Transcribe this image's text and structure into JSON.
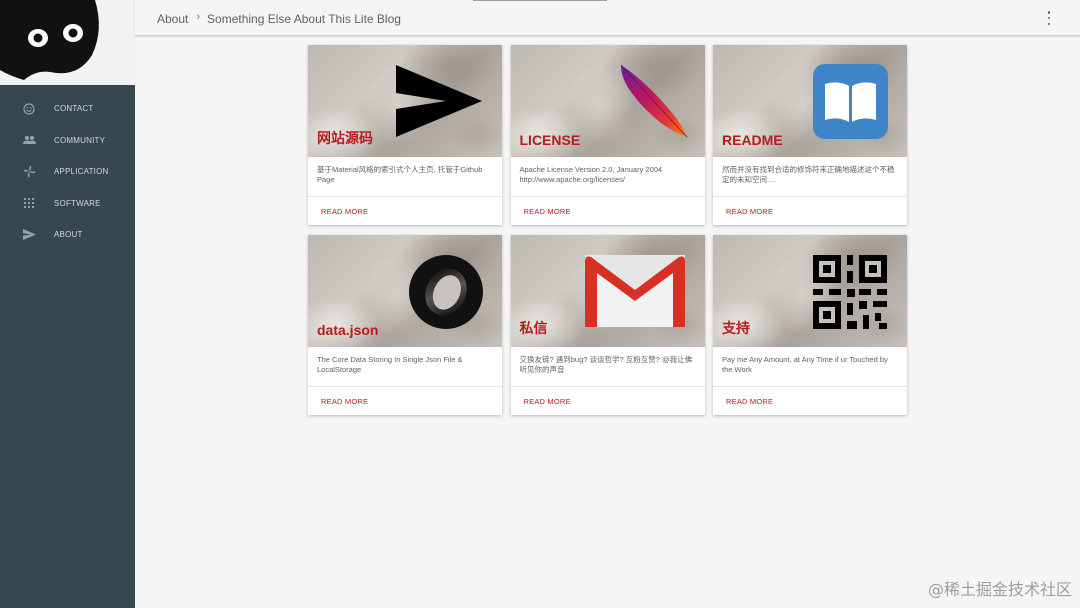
{
  "header": {
    "breadcrumb": [
      "About",
      "Something Else About This Lite Blog"
    ],
    "separator": "›"
  },
  "sidebar": {
    "items": [
      {
        "label": "CONTACT",
        "icon": "smile-icon"
      },
      {
        "label": "COMMUNITY",
        "icon": "group-icon"
      },
      {
        "label": "APPLICATION",
        "icon": "pinwheel-icon"
      },
      {
        "label": "SOFTWARE",
        "icon": "apps-grid-icon"
      },
      {
        "label": "ABOUT",
        "icon": "send-icon"
      }
    ]
  },
  "cards": [
    {
      "title": "网站源码",
      "text": "基于Material风格的索引式个人主页, 托管于Github Page",
      "action": "READ MORE",
      "logo": "send-arrow-icon"
    },
    {
      "title": "LICENSE",
      "text": "Apache License Version 2.0, January 2004 http://www.apache.org/licenses/",
      "action": "READ MORE",
      "logo": "apache-feather-icon"
    },
    {
      "title": "README",
      "text": "然而并没有找到合适的修饰符来正确地描述这个不稳定的未知空间....",
      "action": "READ MORE",
      "logo": "book-icon"
    },
    {
      "title": "data.json",
      "text": "The Core Data Storing In Single Json File & LocalStorage",
      "action": "READ MORE",
      "logo": "json-ring-icon"
    },
    {
      "title": "私信",
      "text": "交换友链? 遇到bug? 谈谈哲学? 互粉互赞? @我让佛听见你的声音",
      "action": "READ MORE",
      "logo": "gmail-icon"
    },
    {
      "title": "支持",
      "text": "Pay me Any Amount, at Any Time if ur Touched by the Work",
      "action": "READ MORE",
      "logo": "qr-code-icon"
    }
  ],
  "watermark": "@稀土掘金技术社区",
  "colors": {
    "sidebar": "#37474f",
    "accent": "#b71c1c",
    "background": "#f5f5f5"
  }
}
